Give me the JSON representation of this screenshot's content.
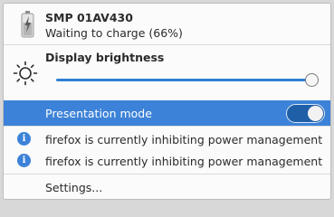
{
  "battery": {
    "name": "SMP 01AV430",
    "status": "Waiting to charge (66%)",
    "icon": "battery-charging-icon"
  },
  "brightness": {
    "title": "Display brightness",
    "icon": "sun-icon",
    "level": 1.0
  },
  "presentation": {
    "label": "Presentation mode",
    "enabled": true
  },
  "inhibitors": [
    {
      "icon": "info-icon",
      "text": "firefox is currently inhibiting power management"
    },
    {
      "icon": "info-icon",
      "text": "firefox is currently inhibiting power management"
    }
  ],
  "settings": {
    "label": "Settings..."
  },
  "colors": {
    "accent": "#3c82d8",
    "background": "#fbfbfb",
    "text": "#2b2b2b"
  }
}
